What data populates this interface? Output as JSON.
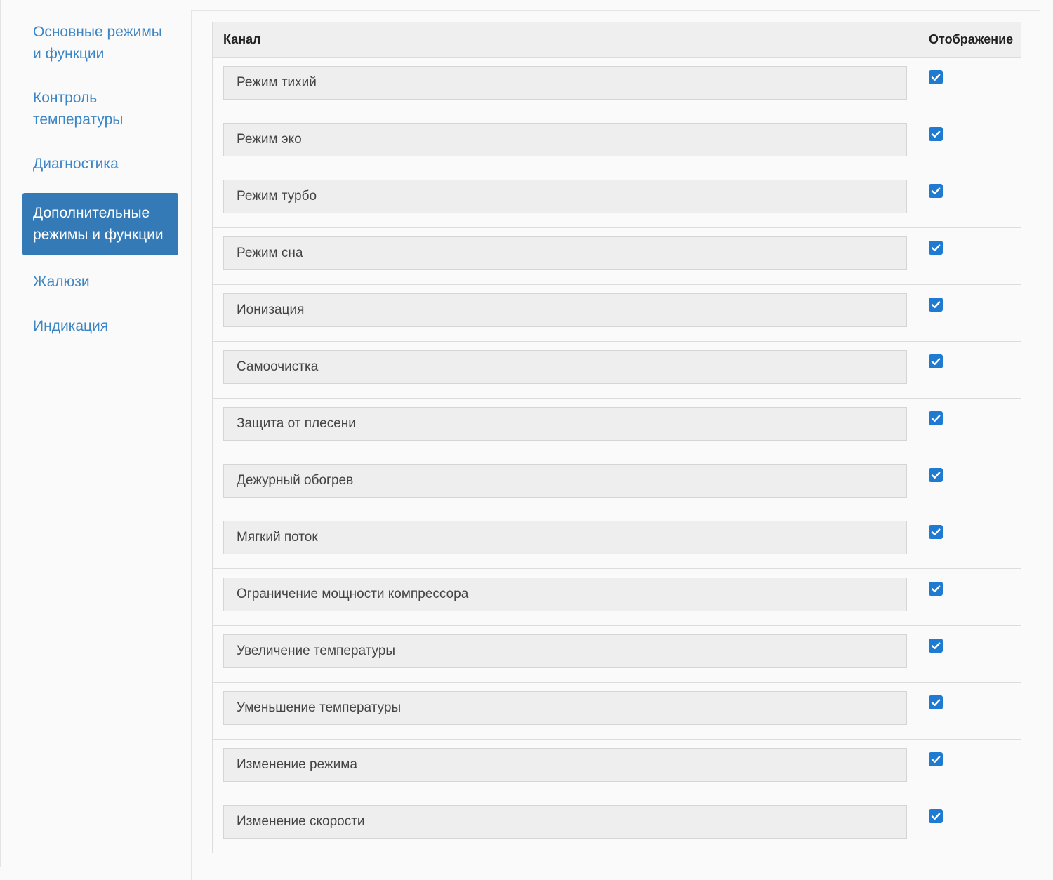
{
  "sidebar": {
    "items": [
      {
        "label": "Основные режимы и функции",
        "active": false
      },
      {
        "label": "Контроль температуры",
        "active": false
      },
      {
        "label": "Диагностика",
        "active": false
      },
      {
        "label": "Дополнительные режимы и функции",
        "active": true
      },
      {
        "label": "Жалюзи",
        "active": false
      },
      {
        "label": "Индикация",
        "active": false
      }
    ]
  },
  "table": {
    "headers": {
      "channel": "Канал",
      "display": "Отображение"
    },
    "rows": [
      {
        "channel": "Режим тихий",
        "display": true
      },
      {
        "channel": "Режим эко",
        "display": true
      },
      {
        "channel": "Режим турбо",
        "display": true
      },
      {
        "channel": "Режим сна",
        "display": true
      },
      {
        "channel": "Ионизация",
        "display": true
      },
      {
        "channel": "Самоочистка",
        "display": true
      },
      {
        "channel": "Защита от плесени",
        "display": true
      },
      {
        "channel": "Дежурный обогрев",
        "display": true
      },
      {
        "channel": "Мягкий поток",
        "display": true
      },
      {
        "channel": "Ограничение мощности компрессора",
        "display": true
      },
      {
        "channel": "Увеличение температуры",
        "display": true
      },
      {
        "channel": "Уменьшение температуры",
        "display": true
      },
      {
        "channel": "Изменение режима",
        "display": true
      },
      {
        "channel": "Изменение скорости",
        "display": true
      }
    ]
  },
  "icons": {
    "checkbox": "checkmark-icon"
  },
  "colors": {
    "accent": "#337ab7",
    "link": "#3d86c6",
    "checkbox": "#1f7ad1"
  }
}
